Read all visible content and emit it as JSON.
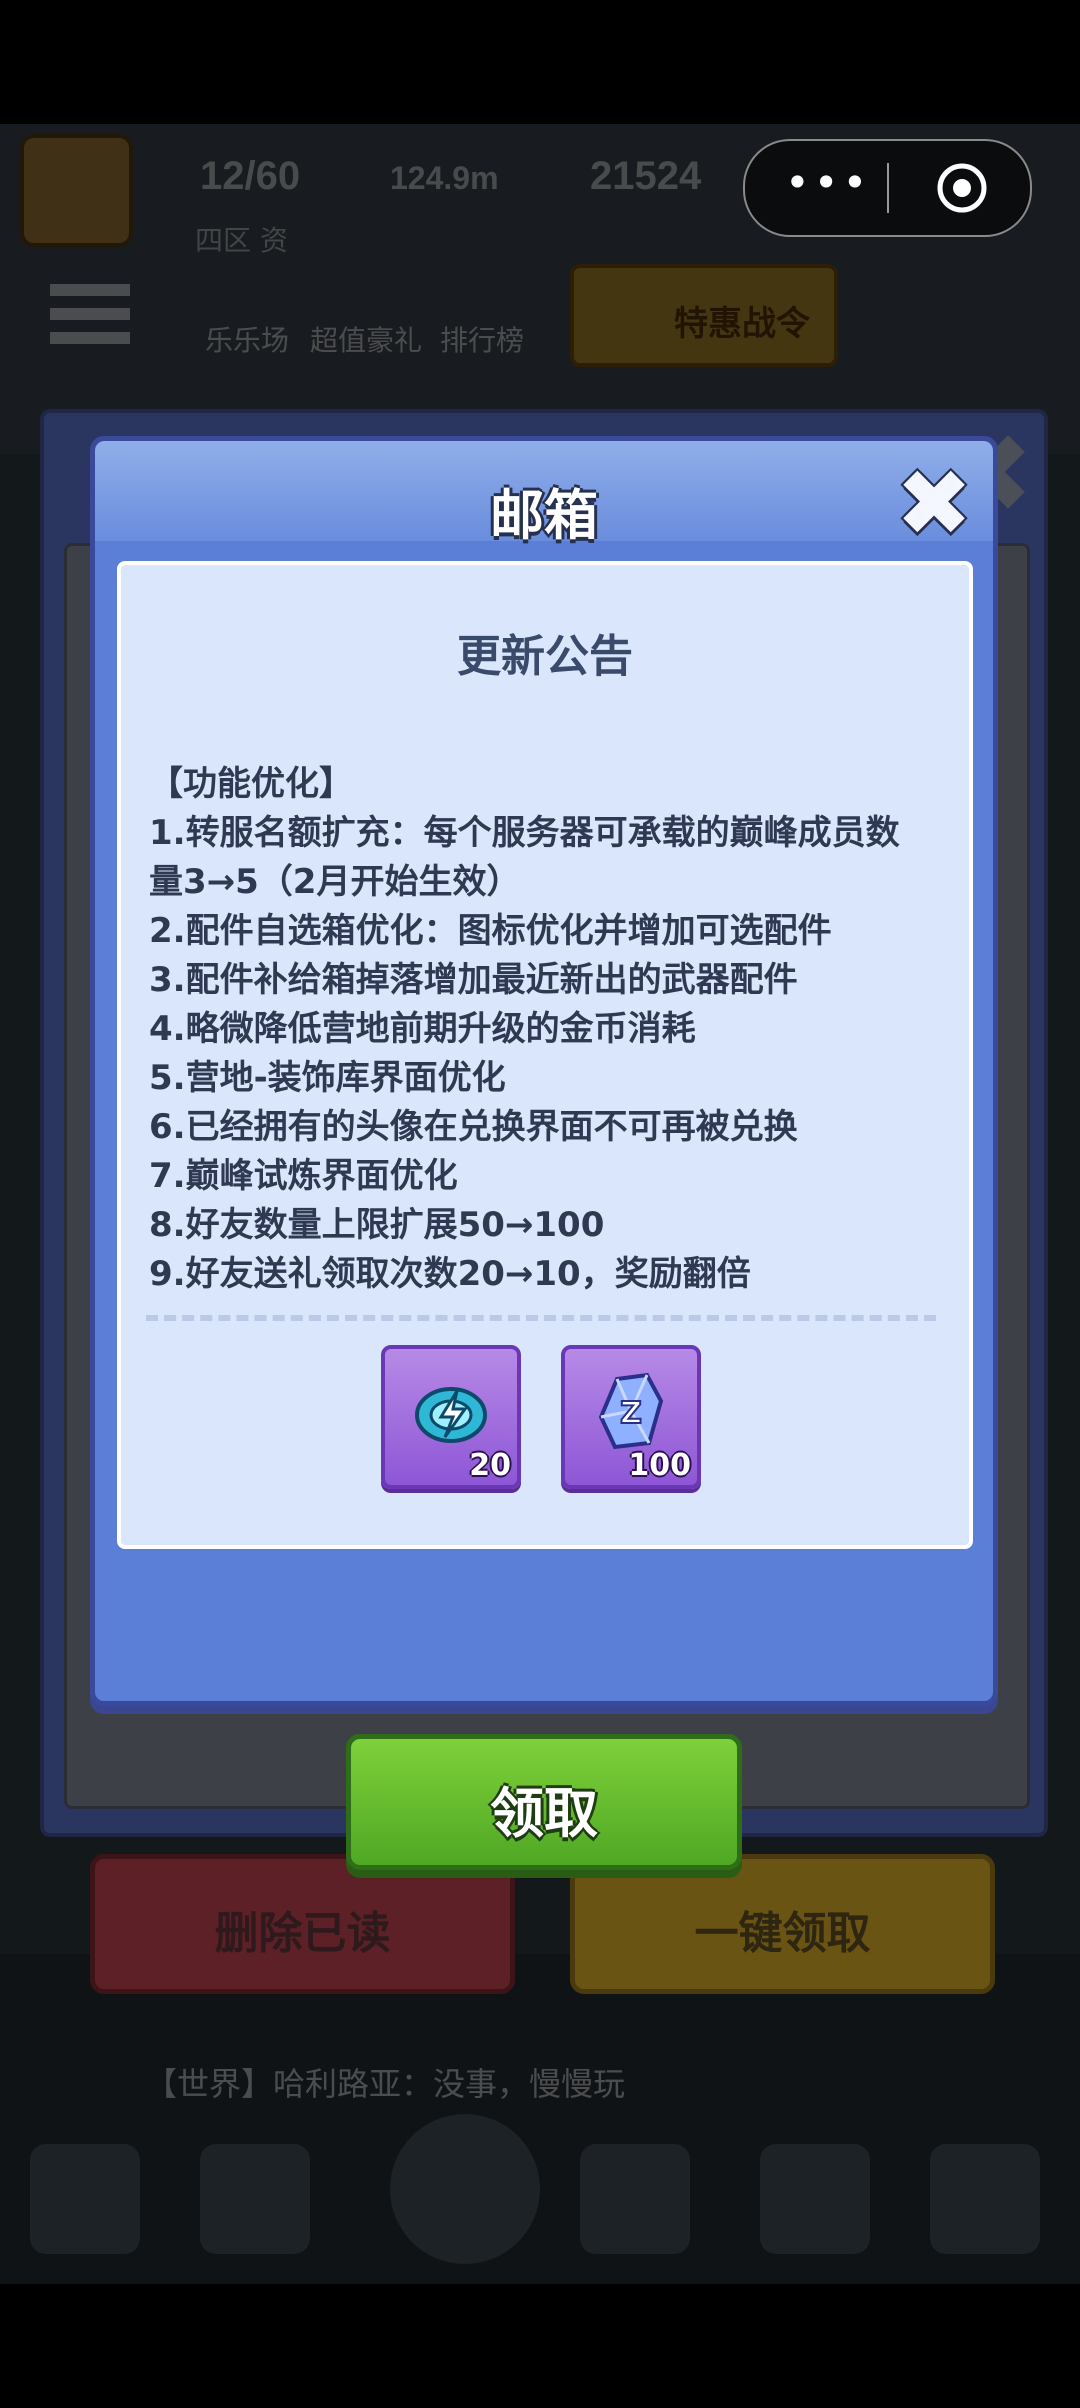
{
  "background": {
    "stats": [
      "12/60",
      "124.9m",
      "21524"
    ],
    "sub_label": "四区 资",
    "nav_items": [
      "乐乐场",
      "超值豪礼",
      "排行榜"
    ],
    "pass_label": "特惠战令",
    "chat": "【世界】哈利路亚：没事，慢慢玩"
  },
  "capsule": {
    "more_label": "•••"
  },
  "outer_panel": {
    "title": "邮箱",
    "close_glyph": "✖",
    "delete_read_label": "删除已读",
    "claim_all_label": "一键领取"
  },
  "dialog": {
    "title": "邮箱",
    "close_glyph": "✖",
    "notice_title": "更新公告",
    "lines": [
      "【功能优化】",
      "1.转服名额扩充：每个服务器可承载的巅峰成员数",
      "量3→5（2月开始生效）",
      "2.配件自选箱优化：图标优化并增加可选配件",
      "3.配件补给箱掉落增加最近新出的武器配件",
      "4.略微降低营地前期升级的金币消耗",
      "5.营地-装饰库界面优化",
      "6.已经拥有的头像在兑换界面不可再被兑换",
      "7.巅峰试炼界面优化",
      "8.好友数量上限扩展50→100",
      "9.好友送礼领取次数20→10，奖励翻倍"
    ],
    "rewards": [
      {
        "icon": "energy-disc-icon",
        "count": "20"
      },
      {
        "icon": "blue-crystal-icon",
        "count": "100"
      }
    ],
    "claim_label": "领取"
  }
}
